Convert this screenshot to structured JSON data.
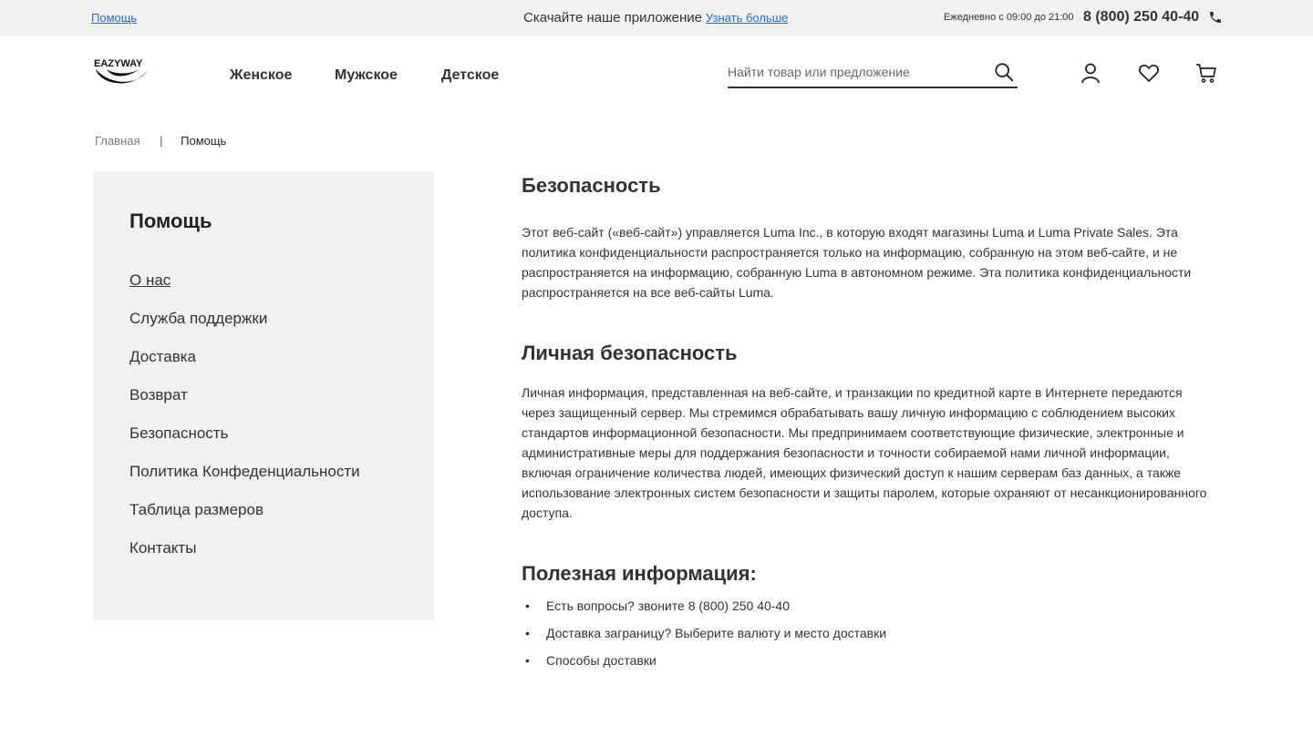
{
  "topbar": {
    "help_link": "Помощь",
    "promo_text": "Скачайте наше приложение",
    "promo_link": "Узнать больше",
    "hours": "Ежедневно с 09:00 до 21:00",
    "phone": "8 (800) 250 40-40"
  },
  "header": {
    "logo_text": "EAZYWAY",
    "nav": [
      "Женское",
      "Мужское",
      "Детское"
    ],
    "search_placeholder": "Найти товар или предложение"
  },
  "breadcrumb": {
    "home": "Главная",
    "separator": "|",
    "current": "Помощь"
  },
  "sidebar": {
    "title": "Помощь",
    "items": [
      {
        "label": "О нас",
        "active": true
      },
      {
        "label": "Служба поддержки"
      },
      {
        "label": "Доставка"
      },
      {
        "label": "Возврат"
      },
      {
        "label": "Безопасность"
      },
      {
        "label": "Политика Конфеденциальности"
      },
      {
        "label": "Таблица размеров"
      },
      {
        "label": "Контакты"
      }
    ]
  },
  "content": {
    "section1_title": "Безопасность",
    "section1_text": "Этот веб-сайт («веб-сайт») управляется Luma Inc., в которую входят магазины Luma и Luma Private Sales. Эта политика конфиденциальности распространяется только на информацию, собранную на этом веб-сайте, и не распространяется на информацию, собранную Luma в автономном режиме. Эта политика конфиденциальности распространяется на все веб-сайты Luma.",
    "section2_title": "Личная безопасность",
    "section2_text": "Личная информация, представленная на веб-сайте, и транзакции по кредитной карте в Интернете передаются через защищенный сервер. Мы стремимся обрабатывать вашу личную информацию с соблюдением высоких стандартов информационной безопасности. Мы предпринимаем соответствующие физические, электронные и административные меры для поддержания безопасности и точности собираемой нами личной информации, включая ограничение количества людей, имеющих физический доступ к нашим серверам баз данных, а также использование электронных систем безопасности и защиты паролем, которые охраняют от несанкционированного доступа.",
    "section3_title": "Полезная информация:",
    "info_items": [
      "Есть вопросы? звоните 8 (800) 250 40-40",
      "Доставка заграницу? Выберите валюту и место доставки",
      "Способы доставки"
    ]
  },
  "colors": {
    "link_blue": "#1f6fd0",
    "panel_gray": "#f0f1f3",
    "text_dark": "#333333"
  }
}
